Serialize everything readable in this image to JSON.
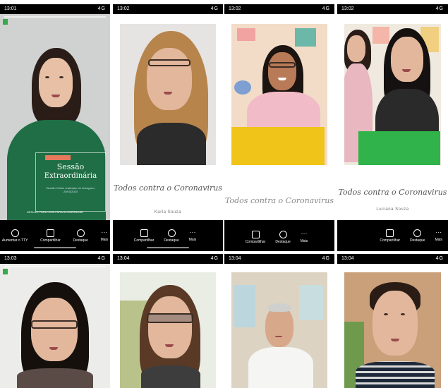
{
  "panels": [
    {
      "time": "13:01",
      "signal": "4G",
      "username": "",
      "title_small": "Sessão",
      "title_big": "Extraordinária",
      "subtitle": "Sessão Online realizada via Instagram, 25/03/2020",
      "cta": "DESLIZE PARA CIMA PARA ACOMPANHAR",
      "actions": [
        "Aumentar o TTY",
        "Compartilhar",
        "Destaque",
        "Mais"
      ]
    },
    {
      "time": "13:02",
      "signal": "4G",
      "script_text": "Todos contra o Coronavirus",
      "credit": "Karla Souza",
      "actions": [
        "Compartilhar",
        "Destaque",
        "Mais"
      ]
    },
    {
      "time": "13:02",
      "signal": "4G",
      "script_text": "Todos contra o Coronavirus",
      "credit": "",
      "actions": [
        "Compartilhar",
        "Destaque",
        "Mais"
      ]
    },
    {
      "time": "13:02",
      "signal": "4G",
      "script_text": "Todos contra o Coronavirus",
      "credit": "Luciana Souza",
      "actions": [
        "Compartilhar",
        "Destaque",
        "Mais"
      ]
    },
    {
      "time": "13:03",
      "signal": "4G"
    },
    {
      "time": "13:04",
      "signal": "4G"
    },
    {
      "time": "13:04",
      "signal": "4G"
    },
    {
      "time": "13:04",
      "signal": "4G"
    }
  ],
  "colors": {
    "green_cover": "#1f6e45",
    "yellow_box": "#f0c419",
    "green_box": "#2fb34a"
  }
}
